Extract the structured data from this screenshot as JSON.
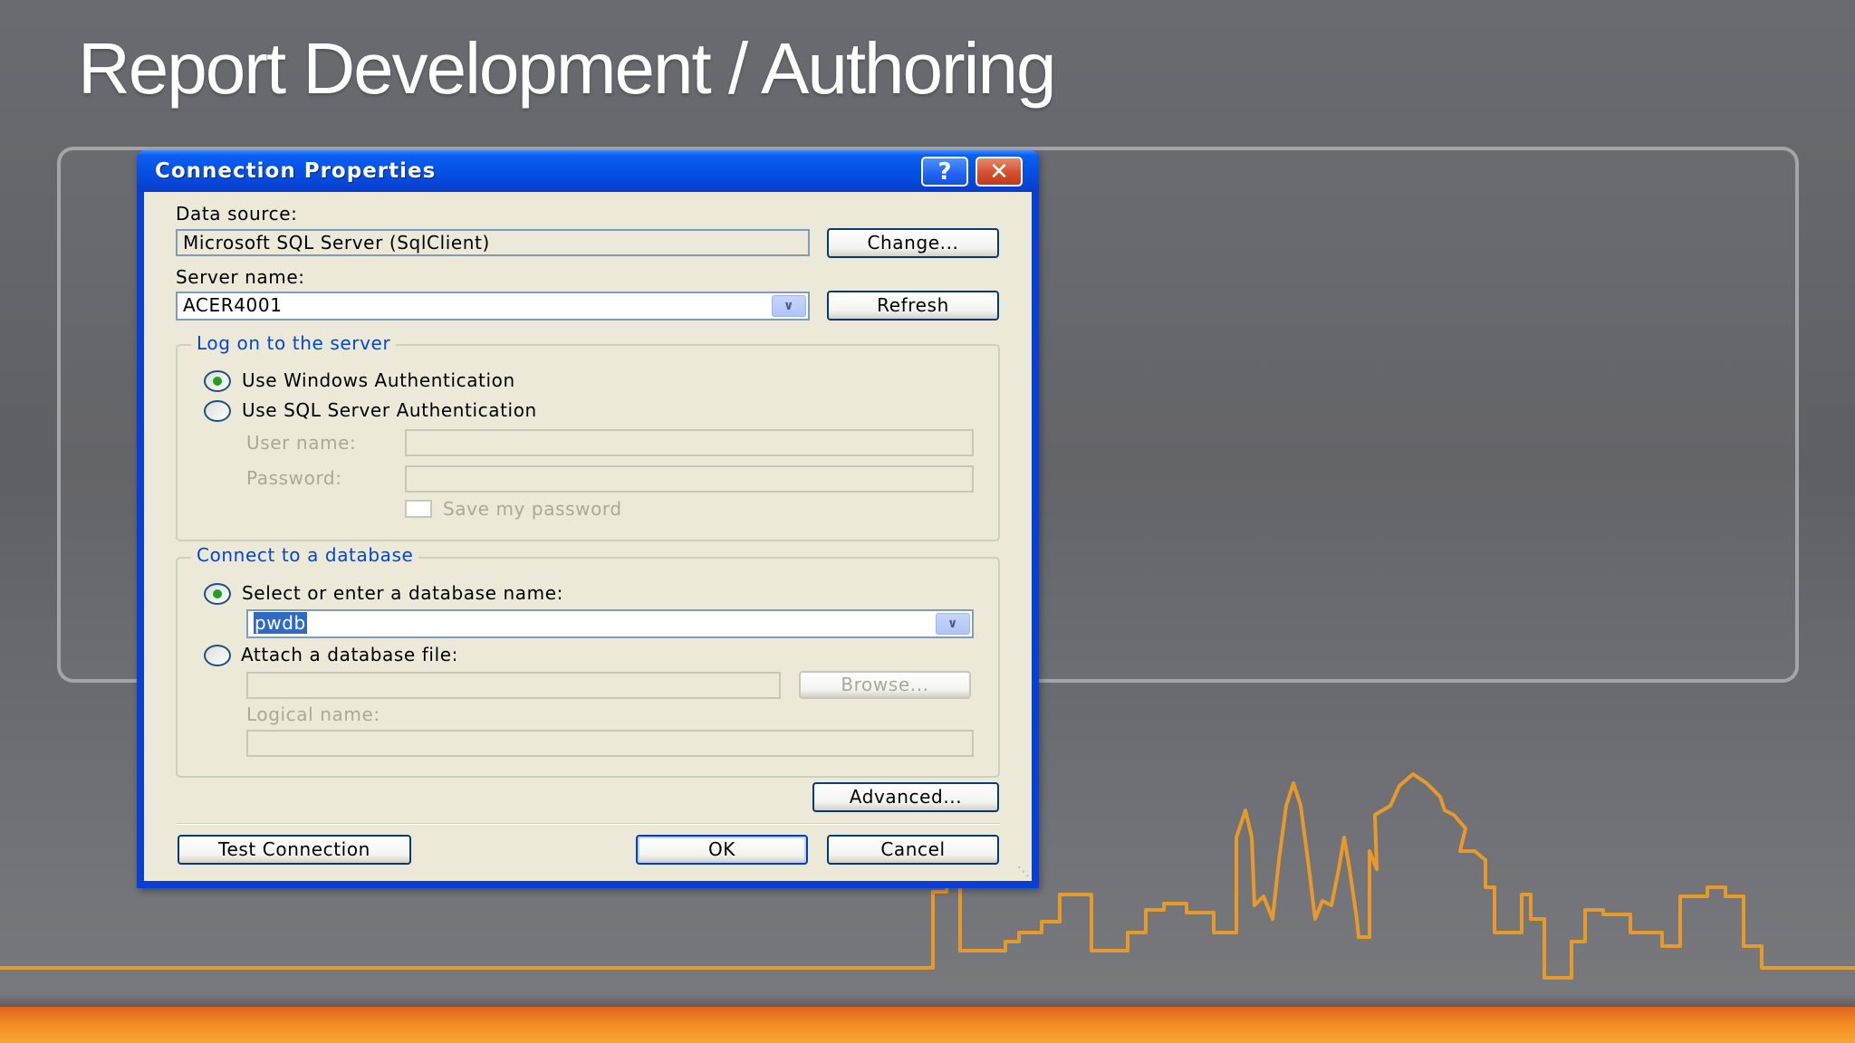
{
  "slide": {
    "title": "Report Development / Authoring"
  },
  "dialog": {
    "title": "Connection Properties",
    "help_label": "?",
    "close_label": "✕",
    "data_source": {
      "label": "Data source:",
      "value": "Microsoft SQL Server (SqlClient)",
      "change_button": "Change..."
    },
    "server": {
      "label": "Server name:",
      "value": "ACER4001",
      "refresh_button": "Refresh"
    },
    "logon_group": {
      "title": "Log on to the server",
      "windows_auth": "Use Windows Authentication",
      "sql_auth": "Use SQL Server Authentication",
      "selected": "windows_auth",
      "user_name_label": "User name:",
      "password_label": "Password:",
      "save_password_label": "Save my password"
    },
    "database_group": {
      "title": "Connect to a database",
      "select_option": "Select or enter a database name:",
      "database_value": "pwdb",
      "attach_option": "Attach a database file:",
      "selected": "select_option",
      "browse_button": "Browse...",
      "logical_name_label": "Logical name:"
    },
    "buttons": {
      "advanced": "Advanced...",
      "test_connection": "Test Connection",
      "ok": "OK",
      "cancel": "Cancel"
    }
  },
  "colors": {
    "title_bar": "#0553e6",
    "dialog_face": "#ece9d8",
    "group_title": "#0046d5",
    "skyline": "#f0a22a",
    "bottom_bar": "#f28b22"
  }
}
